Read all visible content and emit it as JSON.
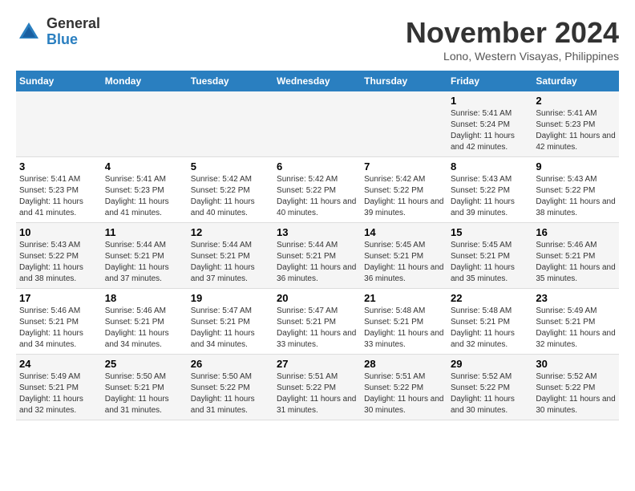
{
  "logo": {
    "general": "General",
    "blue": "Blue"
  },
  "title": "November 2024",
  "location": "Lono, Western Visayas, Philippines",
  "days_of_week": [
    "Sunday",
    "Monday",
    "Tuesday",
    "Wednesday",
    "Thursday",
    "Friday",
    "Saturday"
  ],
  "weeks": [
    {
      "days": [
        {
          "num": "",
          "info": ""
        },
        {
          "num": "",
          "info": ""
        },
        {
          "num": "",
          "info": ""
        },
        {
          "num": "",
          "info": ""
        },
        {
          "num": "",
          "info": ""
        },
        {
          "num": "1",
          "info": "Sunrise: 5:41 AM\nSunset: 5:24 PM\nDaylight: 11 hours and 42 minutes."
        },
        {
          "num": "2",
          "info": "Sunrise: 5:41 AM\nSunset: 5:23 PM\nDaylight: 11 hours and 42 minutes."
        }
      ]
    },
    {
      "days": [
        {
          "num": "3",
          "info": "Sunrise: 5:41 AM\nSunset: 5:23 PM\nDaylight: 11 hours and 41 minutes."
        },
        {
          "num": "4",
          "info": "Sunrise: 5:41 AM\nSunset: 5:23 PM\nDaylight: 11 hours and 41 minutes."
        },
        {
          "num": "5",
          "info": "Sunrise: 5:42 AM\nSunset: 5:22 PM\nDaylight: 11 hours and 40 minutes."
        },
        {
          "num": "6",
          "info": "Sunrise: 5:42 AM\nSunset: 5:22 PM\nDaylight: 11 hours and 40 minutes."
        },
        {
          "num": "7",
          "info": "Sunrise: 5:42 AM\nSunset: 5:22 PM\nDaylight: 11 hours and 39 minutes."
        },
        {
          "num": "8",
          "info": "Sunrise: 5:43 AM\nSunset: 5:22 PM\nDaylight: 11 hours and 39 minutes."
        },
        {
          "num": "9",
          "info": "Sunrise: 5:43 AM\nSunset: 5:22 PM\nDaylight: 11 hours and 38 minutes."
        }
      ]
    },
    {
      "days": [
        {
          "num": "10",
          "info": "Sunrise: 5:43 AM\nSunset: 5:22 PM\nDaylight: 11 hours and 38 minutes."
        },
        {
          "num": "11",
          "info": "Sunrise: 5:44 AM\nSunset: 5:21 PM\nDaylight: 11 hours and 37 minutes."
        },
        {
          "num": "12",
          "info": "Sunrise: 5:44 AM\nSunset: 5:21 PM\nDaylight: 11 hours and 37 minutes."
        },
        {
          "num": "13",
          "info": "Sunrise: 5:44 AM\nSunset: 5:21 PM\nDaylight: 11 hours and 36 minutes."
        },
        {
          "num": "14",
          "info": "Sunrise: 5:45 AM\nSunset: 5:21 PM\nDaylight: 11 hours and 36 minutes."
        },
        {
          "num": "15",
          "info": "Sunrise: 5:45 AM\nSunset: 5:21 PM\nDaylight: 11 hours and 35 minutes."
        },
        {
          "num": "16",
          "info": "Sunrise: 5:46 AM\nSunset: 5:21 PM\nDaylight: 11 hours and 35 minutes."
        }
      ]
    },
    {
      "days": [
        {
          "num": "17",
          "info": "Sunrise: 5:46 AM\nSunset: 5:21 PM\nDaylight: 11 hours and 34 minutes."
        },
        {
          "num": "18",
          "info": "Sunrise: 5:46 AM\nSunset: 5:21 PM\nDaylight: 11 hours and 34 minutes."
        },
        {
          "num": "19",
          "info": "Sunrise: 5:47 AM\nSunset: 5:21 PM\nDaylight: 11 hours and 34 minutes."
        },
        {
          "num": "20",
          "info": "Sunrise: 5:47 AM\nSunset: 5:21 PM\nDaylight: 11 hours and 33 minutes."
        },
        {
          "num": "21",
          "info": "Sunrise: 5:48 AM\nSunset: 5:21 PM\nDaylight: 11 hours and 33 minutes."
        },
        {
          "num": "22",
          "info": "Sunrise: 5:48 AM\nSunset: 5:21 PM\nDaylight: 11 hours and 32 minutes."
        },
        {
          "num": "23",
          "info": "Sunrise: 5:49 AM\nSunset: 5:21 PM\nDaylight: 11 hours and 32 minutes."
        }
      ]
    },
    {
      "days": [
        {
          "num": "24",
          "info": "Sunrise: 5:49 AM\nSunset: 5:21 PM\nDaylight: 11 hours and 32 minutes."
        },
        {
          "num": "25",
          "info": "Sunrise: 5:50 AM\nSunset: 5:21 PM\nDaylight: 11 hours and 31 minutes."
        },
        {
          "num": "26",
          "info": "Sunrise: 5:50 AM\nSunset: 5:22 PM\nDaylight: 11 hours and 31 minutes."
        },
        {
          "num": "27",
          "info": "Sunrise: 5:51 AM\nSunset: 5:22 PM\nDaylight: 11 hours and 31 minutes."
        },
        {
          "num": "28",
          "info": "Sunrise: 5:51 AM\nSunset: 5:22 PM\nDaylight: 11 hours and 30 minutes."
        },
        {
          "num": "29",
          "info": "Sunrise: 5:52 AM\nSunset: 5:22 PM\nDaylight: 11 hours and 30 minutes."
        },
        {
          "num": "30",
          "info": "Sunrise: 5:52 AM\nSunset: 5:22 PM\nDaylight: 11 hours and 30 minutes."
        }
      ]
    }
  ]
}
